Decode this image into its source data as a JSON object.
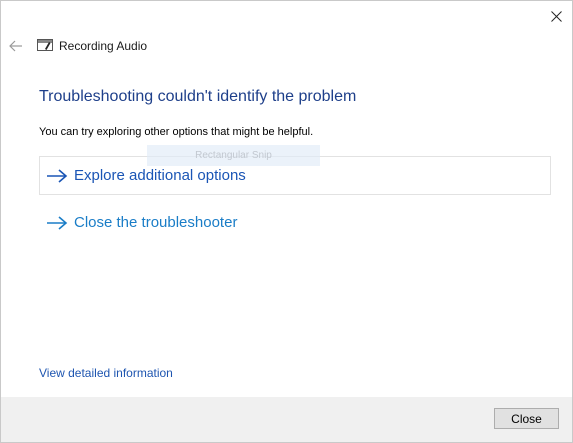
{
  "window": {
    "title": "Recording Audio",
    "icons": {
      "back": "back-arrow-icon",
      "close": "close-icon",
      "app": "troubleshooter-icon"
    }
  },
  "main": {
    "heading": "Troubleshooting couldn't identify the problem",
    "subtext": "You can try exploring other options that might be helpful.",
    "options": [
      {
        "label": "Explore additional options",
        "icon": "arrow-right-icon"
      },
      {
        "label": "Close the troubleshooter",
        "icon": "arrow-right-icon"
      }
    ],
    "ghost_tooltip": "Rectangular Snip",
    "details_link": "View detailed information"
  },
  "footer": {
    "close_label": "Close"
  },
  "colors": {
    "heading": "#1e3f8a",
    "link": "#1a55b5",
    "link_light": "#1a7dc7",
    "footer_bg": "#f0f0f0"
  }
}
